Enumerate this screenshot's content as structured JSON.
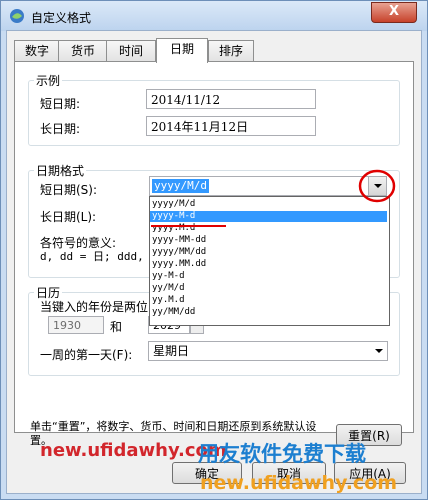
{
  "window": {
    "title": "自定义格式",
    "close_label": "X"
  },
  "tabs": [
    {
      "label": "数字"
    },
    {
      "label": "货币"
    },
    {
      "label": "时间"
    },
    {
      "label": "日期"
    },
    {
      "label": "排序"
    }
  ],
  "example": {
    "group_label": "示例",
    "short_label": "短日期:",
    "short_value": "2014/11/12",
    "long_label": "长日期:",
    "long_value": "2014年11月12日"
  },
  "date_format": {
    "group_label": "日期格式",
    "short_label": "短日期(S):",
    "short_value": "yyyy/M/d",
    "long_label": "长日期(L):",
    "symbols_label": "各符号的意义:",
    "symbols_text": "d, dd = 日;  ddd,",
    "options": [
      "yyyy/M/d",
      "yyyy-M-d",
      "yyyy.M.d",
      "yyyy-MM-dd",
      "yyyy/MM/dd",
      "yyyy.MM.dd",
      "yy-M-d",
      "yy/M/d",
      "yy.M.d",
      "yy/MM/dd"
    ]
  },
  "calendar": {
    "group_label": "日历",
    "two_digit_label": "当键入的年份是两位",
    "year_from": "1930",
    "and_label": "和",
    "year_to": "2029",
    "first_day_label": "一周的第一天(F):",
    "first_day_value": "星期日"
  },
  "footer": {
    "reset_text": "单击“重置”，将数字、货币、时间和日期还原到系统默认设置。",
    "reset_button": "重置(R)",
    "ok_button": "确定",
    "cancel_button": "取消",
    "apply_button": "应用(A)"
  },
  "watermark": {
    "url_left": "new.ufidawhy.com",
    "brand": "用友软件免费下载",
    "url_bottom": "new.ufidawhy.com"
  },
  "colors": {
    "accent": "#3399ff",
    "annotation_red": "#e00000"
  }
}
